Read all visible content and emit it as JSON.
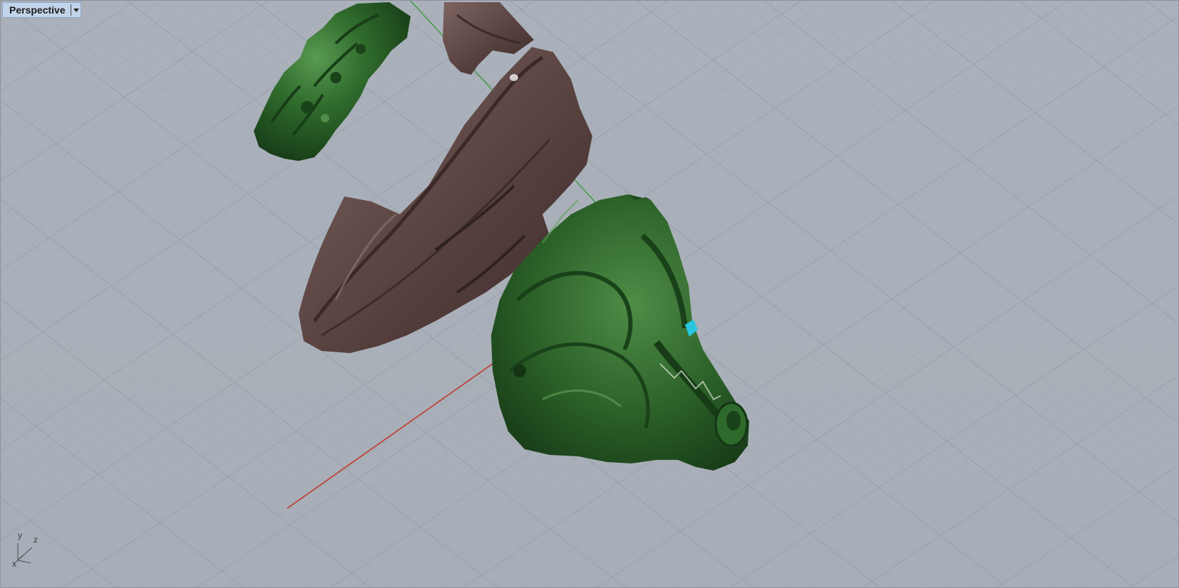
{
  "viewport": {
    "title": "Perspective",
    "menu_icon": "dropdown-arrow-icon"
  },
  "triad": {
    "x_label": "x",
    "y_label": "y",
    "z_label": "z"
  },
  "colors": {
    "background": "#a9b0b9",
    "grid_minor": "#9aa2ac",
    "grid_major": "#8c949e",
    "x_axis": "#c0392b",
    "y_axis": "#3f9b3f",
    "green_model": "#2f6b2c",
    "brown_model": "#5b4442",
    "eye_accent": "#29c6e0",
    "tab_background": "#c2d4ea"
  },
  "scene_objects": [
    "green-filigree-part",
    "brown-ring-shank",
    "green-wolf-head",
    "brown-curved-part"
  ]
}
